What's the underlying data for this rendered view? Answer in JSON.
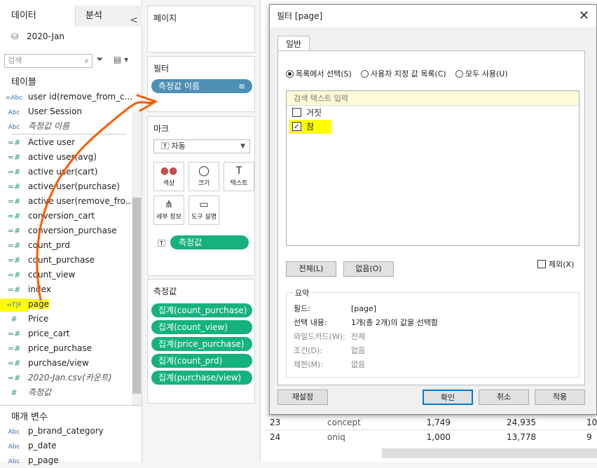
{
  "left_pane": {
    "tab_data": "데이터",
    "tab_analysis": "분석",
    "collapse": "<",
    "datasource": "2020-Jan",
    "search_placeholder": "검색",
    "tables_header": "테이블",
    "fields_dim": [
      {
        "type": "=Abc",
        "name": "user id(remove_from_c..."
      },
      {
        "type": "Abc",
        "name": "User Session"
      },
      {
        "type": "Abc",
        "name": "측정값 이름"
      }
    ],
    "fields_meas": [
      {
        "type": "=#",
        "name": "Active user"
      },
      {
        "type": "=#",
        "name": "active user(avg)"
      },
      {
        "type": "=#",
        "name": "active user(cart)"
      },
      {
        "type": "=#",
        "name": "active user(purchase)"
      },
      {
        "type": "=#",
        "name": "active user(remove_fro..."
      },
      {
        "type": "=#",
        "name": "conversion_cart"
      },
      {
        "type": "=#",
        "name": "conversion_purchase"
      },
      {
        "type": "=#",
        "name": "count_prd"
      },
      {
        "type": "=#",
        "name": "count_purchase"
      },
      {
        "type": "=#",
        "name": "count_view"
      },
      {
        "type": "=#",
        "name": "index"
      },
      {
        "type": "=T|F",
        "name": "page"
      },
      {
        "type": "#",
        "name": "Price"
      },
      {
        "type": "=#",
        "name": "price_cart"
      },
      {
        "type": "=#",
        "name": "price_purchase"
      },
      {
        "type": "=#",
        "name": "purchase/view"
      },
      {
        "type": "=#",
        "name": "2020-Jan.csv(카운트)"
      },
      {
        "type": "#",
        "name": "측정값"
      }
    ],
    "params_header": "매개 변수",
    "params": [
      {
        "type": "Abc",
        "name": "p_brand_category"
      },
      {
        "type": "Abc",
        "name": "p_date"
      },
      {
        "type": "Abc",
        "name": "p_page"
      }
    ]
  },
  "shelves": {
    "pages": "페이지",
    "filters": "필터",
    "filter_pill": "측정값 이름",
    "marks": "마크",
    "mark_type": "자동",
    "mark_buttons": [
      {
        "icon": "●●",
        "label": "색상"
      },
      {
        "icon": "◯",
        "label": "크기"
      },
      {
        "icon": "T",
        "label": "텍스트"
      },
      {
        "icon": "⋔",
        "label": "세부 정보"
      },
      {
        "icon": "▭",
        "label": "도구 설명"
      }
    ],
    "mark_pill": "측정값",
    "measure_values": "측정값",
    "measure_pills": [
      "집계(count_purchase)",
      "집계(count_view)",
      "집계(price_purchase)",
      "집계(count_prd)",
      "집계(purchase/view)"
    ]
  },
  "view_rows": [
    {
      "idx": "23",
      "name": "concept",
      "a": "1,749",
      "b": "24,935",
      "c": "10"
    },
    {
      "idx": "24",
      "name": "oniq",
      "a": "1,000",
      "b": "13,778",
      "c": "9"
    }
  ],
  "dialog": {
    "title": "필터 [page]",
    "close": "✕",
    "tab": "일반",
    "radio_list": "목록에서 선택(S)",
    "radio_custom": "사용자 지정 값 목록(C)",
    "radio_all": "모두 사용(U)",
    "search_placeholder": "검색 텍스트 입력",
    "items": [
      {
        "label": "거짓",
        "checked": false
      },
      {
        "label": "참",
        "checked": true
      }
    ],
    "btn_all": "전체(L)",
    "btn_none": "없음(O)",
    "exclude": "제외(X)",
    "summary_header": "요약",
    "summary": [
      {
        "k": "필드:",
        "v": "[page]",
        "dim": false
      },
      {
        "k": "선택 내용:",
        "v": "1개(총 2개)의 값을 선택함",
        "dim": false
      },
      {
        "k": "와일드카드(W):",
        "v": "전체",
        "dim": true
      },
      {
        "k": "조건(D):",
        "v": "없음",
        "dim": true
      },
      {
        "k": "제한(M):",
        "v": "없음",
        "dim": true
      }
    ],
    "btn_reset": "재설정",
    "btn_ok": "확인",
    "btn_cancel": "취소",
    "btn_apply": "적용"
  },
  "colors": {
    "pill_blue": "#4d8fb5",
    "pill_green": "#16b27e",
    "highlight": "#ffff00",
    "annotation": "#ff5a00"
  }
}
